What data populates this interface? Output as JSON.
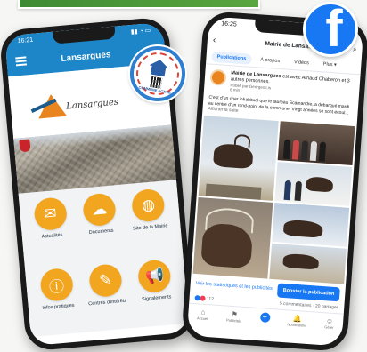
{
  "brand": {
    "accent": "#1c86c9",
    "tile_color": "#f2a51e",
    "facebook_blue": "#1877f2"
  },
  "facebook_logo": {
    "glyph": "f"
  },
  "app": {
    "status_time": "16:21",
    "title": "Lansargues",
    "logo_text": "Lansargues",
    "tiles": [
      {
        "icon": "megaphone-news-icon",
        "glyph": "✉",
        "label": "Actualités"
      },
      {
        "icon": "cloud-documents-icon",
        "glyph": "☁",
        "label": "Documents"
      },
      {
        "icon": "globe-icon",
        "glyph": "◍",
        "label": "Site de la Mairie"
      },
      {
        "icon": "info-icon",
        "glyph": "ⓘ",
        "label": "Infos pratiques"
      },
      {
        "icon": "clipboard-icon",
        "glyph": "✎",
        "label": "Centres d'intérêts"
      },
      {
        "icon": "megaphone-icon",
        "glyph": "📢",
        "label": "Signalements"
      }
    ]
  },
  "facebook": {
    "status_time": "16:25",
    "page_name": "Mairie de Lansa...",
    "tabs": [
      "Publications",
      "À propos",
      "Vidéos",
      "Plus ▾"
    ],
    "post": {
      "author": "Mairie de Lansargues",
      "author_suffix": " est avec Arnaud Chaberon et 3 autres personnes.",
      "posted_by": "Publié par Georges Lis",
      "time": "6 min · ",
      "body": "C'est d'un char inhabituel que le taureau Scamandre, a débarqué mardi au centre d'un rond-point de la commune. Vingt années se sont écoul...",
      "see_more": "Afficher la suite"
    },
    "stats_link": "Voir les statistiques et les publicités",
    "boost_button": "Booster la publication",
    "reactions_count": "112",
    "comments": "5 commentaires",
    "shares": "20 partages",
    "nav": [
      {
        "icon": "home-icon",
        "glyph": "⌂",
        "label": "Accueil"
      },
      {
        "icon": "flag-icon",
        "glyph": "⚑",
        "label": "Publicités"
      },
      {
        "icon": "plus-icon",
        "glyph": "+",
        "label": ""
      },
      {
        "icon": "bell-icon",
        "glyph": "🔔",
        "label": "Notifications"
      },
      {
        "icon": "profile-icon",
        "glyph": "☺",
        "label": "Gérer"
      }
    ]
  },
  "seal": {
    "text": "COMMUNE ACTIVE"
  }
}
